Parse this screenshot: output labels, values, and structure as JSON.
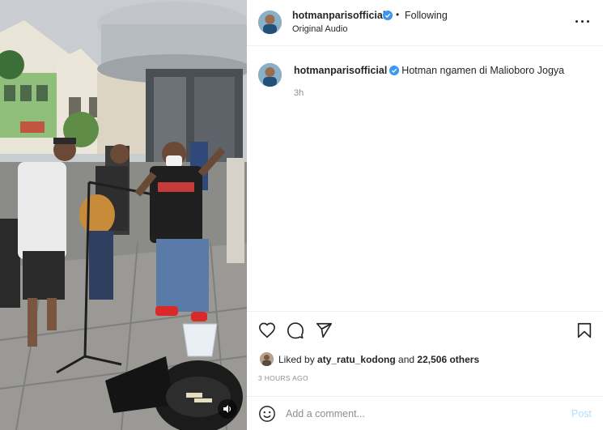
{
  "post": {
    "username": "hotmanparisofficial",
    "dot": "•",
    "follow_state": "Following",
    "audio": "Original Audio",
    "caption": "Hotman ngamen di Malioboro Jogya",
    "caption_time": "3h",
    "liked_by_prefix": "Liked by ",
    "liked_by_user": "aty_ratu_kodong",
    "liked_by_and": " and ",
    "liked_by_others": "22,506 others",
    "date": "3 HOURS AGO"
  },
  "comment": {
    "placeholder": "Add a comment...",
    "post_label": "Post"
  },
  "icons": {
    "verified": "verified-badge-icon",
    "more": "more-options-icon",
    "like": "heart-icon",
    "comment": "comment-icon",
    "share": "share-icon",
    "save": "bookmark-icon",
    "emoji": "emoji-icon",
    "mute": "speaker-icon"
  },
  "colors": {
    "verified": "#3897f0",
    "text": "#262626",
    "muted": "#8e8e8e",
    "post_disabled": "#b2dffc",
    "divider": "#efefef"
  }
}
